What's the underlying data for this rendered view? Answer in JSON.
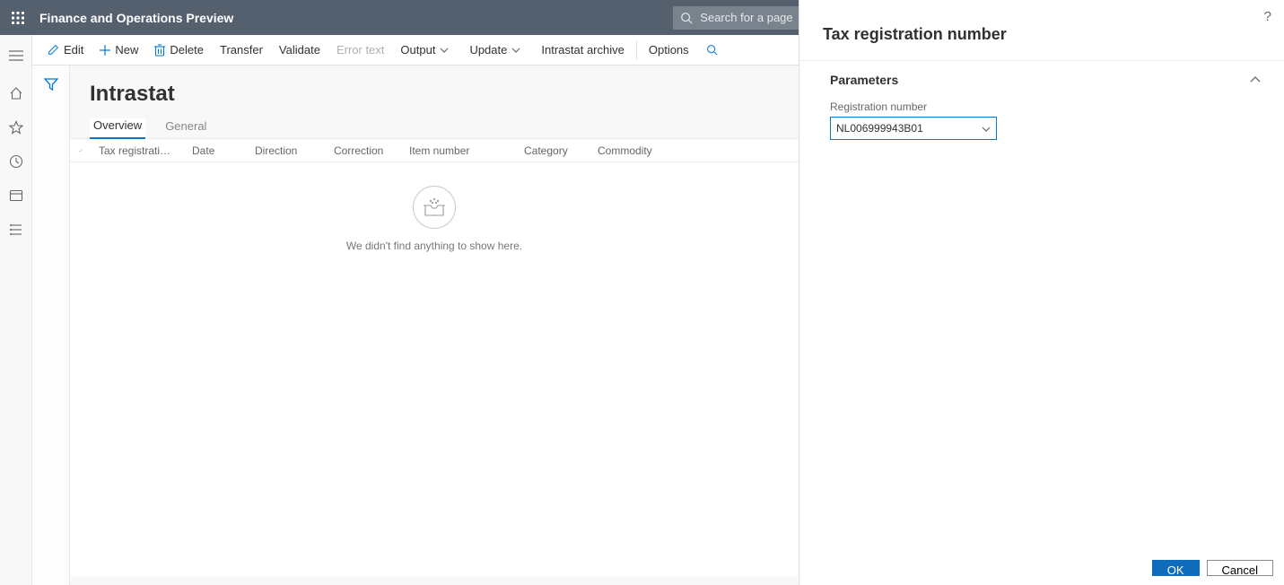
{
  "app": {
    "title": "Finance and Operations Preview",
    "search_placeholder": "Search for a page"
  },
  "actionbar": {
    "edit": "Edit",
    "new": "New",
    "delete": "Delete",
    "transfer": "Transfer",
    "validate": "Validate",
    "error_text": "Error text",
    "output": "Output",
    "update": "Update",
    "intrastat_archive": "Intrastat archive",
    "options": "Options"
  },
  "page": {
    "title": "Intrastat",
    "tabs": {
      "overview": "Overview",
      "general": "General"
    },
    "columns": {
      "tax_reg": "Tax registration num...",
      "date": "Date",
      "direction": "Direction",
      "correction": "Correction",
      "item_number": "Item number",
      "category": "Category",
      "commodity": "Commodity"
    },
    "empty": "We didn't find anything to show here."
  },
  "panel": {
    "title": "Tax registration number",
    "section": "Parameters",
    "field_label": "Registration number",
    "field_value": "NL006999943B01",
    "ok": "OK",
    "cancel": "Cancel"
  }
}
